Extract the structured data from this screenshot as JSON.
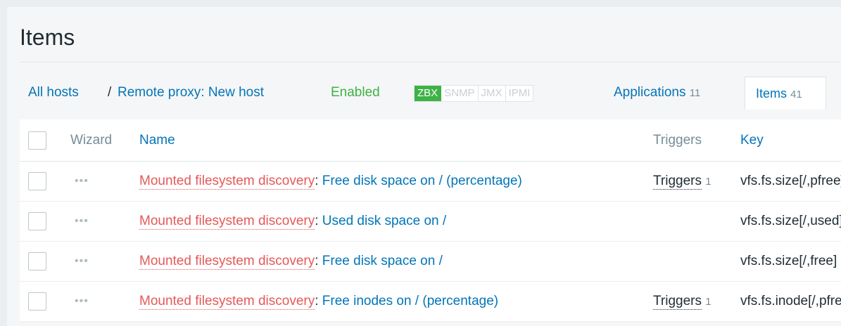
{
  "page": {
    "title": "Items"
  },
  "nav": {
    "all_hosts": "All hosts",
    "separator": "/",
    "host": "Remote proxy: New host",
    "status": "Enabled",
    "availability": [
      "ZBX",
      "SNMP",
      "JMX",
      "IPMI"
    ],
    "applications_label": "Applications",
    "applications_count": "11",
    "items_label": "Items",
    "items_count": "41"
  },
  "table": {
    "columns": {
      "wizard": "Wizard",
      "name": "Name",
      "triggers": "Triggers",
      "key": "Key"
    },
    "wizard_glyph": "•••",
    "rows": [
      {
        "prototype": "Mounted filesystem discovery",
        "colon": ":",
        "name": "Free disk space on / (percentage)",
        "triggers_label": "Triggers",
        "triggers_count": "1",
        "key": "vfs.fs.size[/,pfree]"
      },
      {
        "prototype": "Mounted filesystem discovery",
        "colon": ":",
        "name": "Used disk space on /",
        "triggers_label": "",
        "triggers_count": "",
        "key": "vfs.fs.size[/,used]"
      },
      {
        "prototype": "Mounted filesystem discovery",
        "colon": ":",
        "name": "Free disk space on /",
        "triggers_label": "",
        "triggers_count": "",
        "key": "vfs.fs.size[/,free]"
      },
      {
        "prototype": "Mounted filesystem discovery",
        "colon": ":",
        "name": "Free inodes on / (percentage)",
        "triggers_label": "Triggers",
        "triggers_count": "1",
        "key": "vfs.fs.inode[/,pfree]"
      }
    ]
  },
  "colors": {
    "link": "#0275b8",
    "prototype": "#e45959",
    "enabled": "#3eb246"
  }
}
